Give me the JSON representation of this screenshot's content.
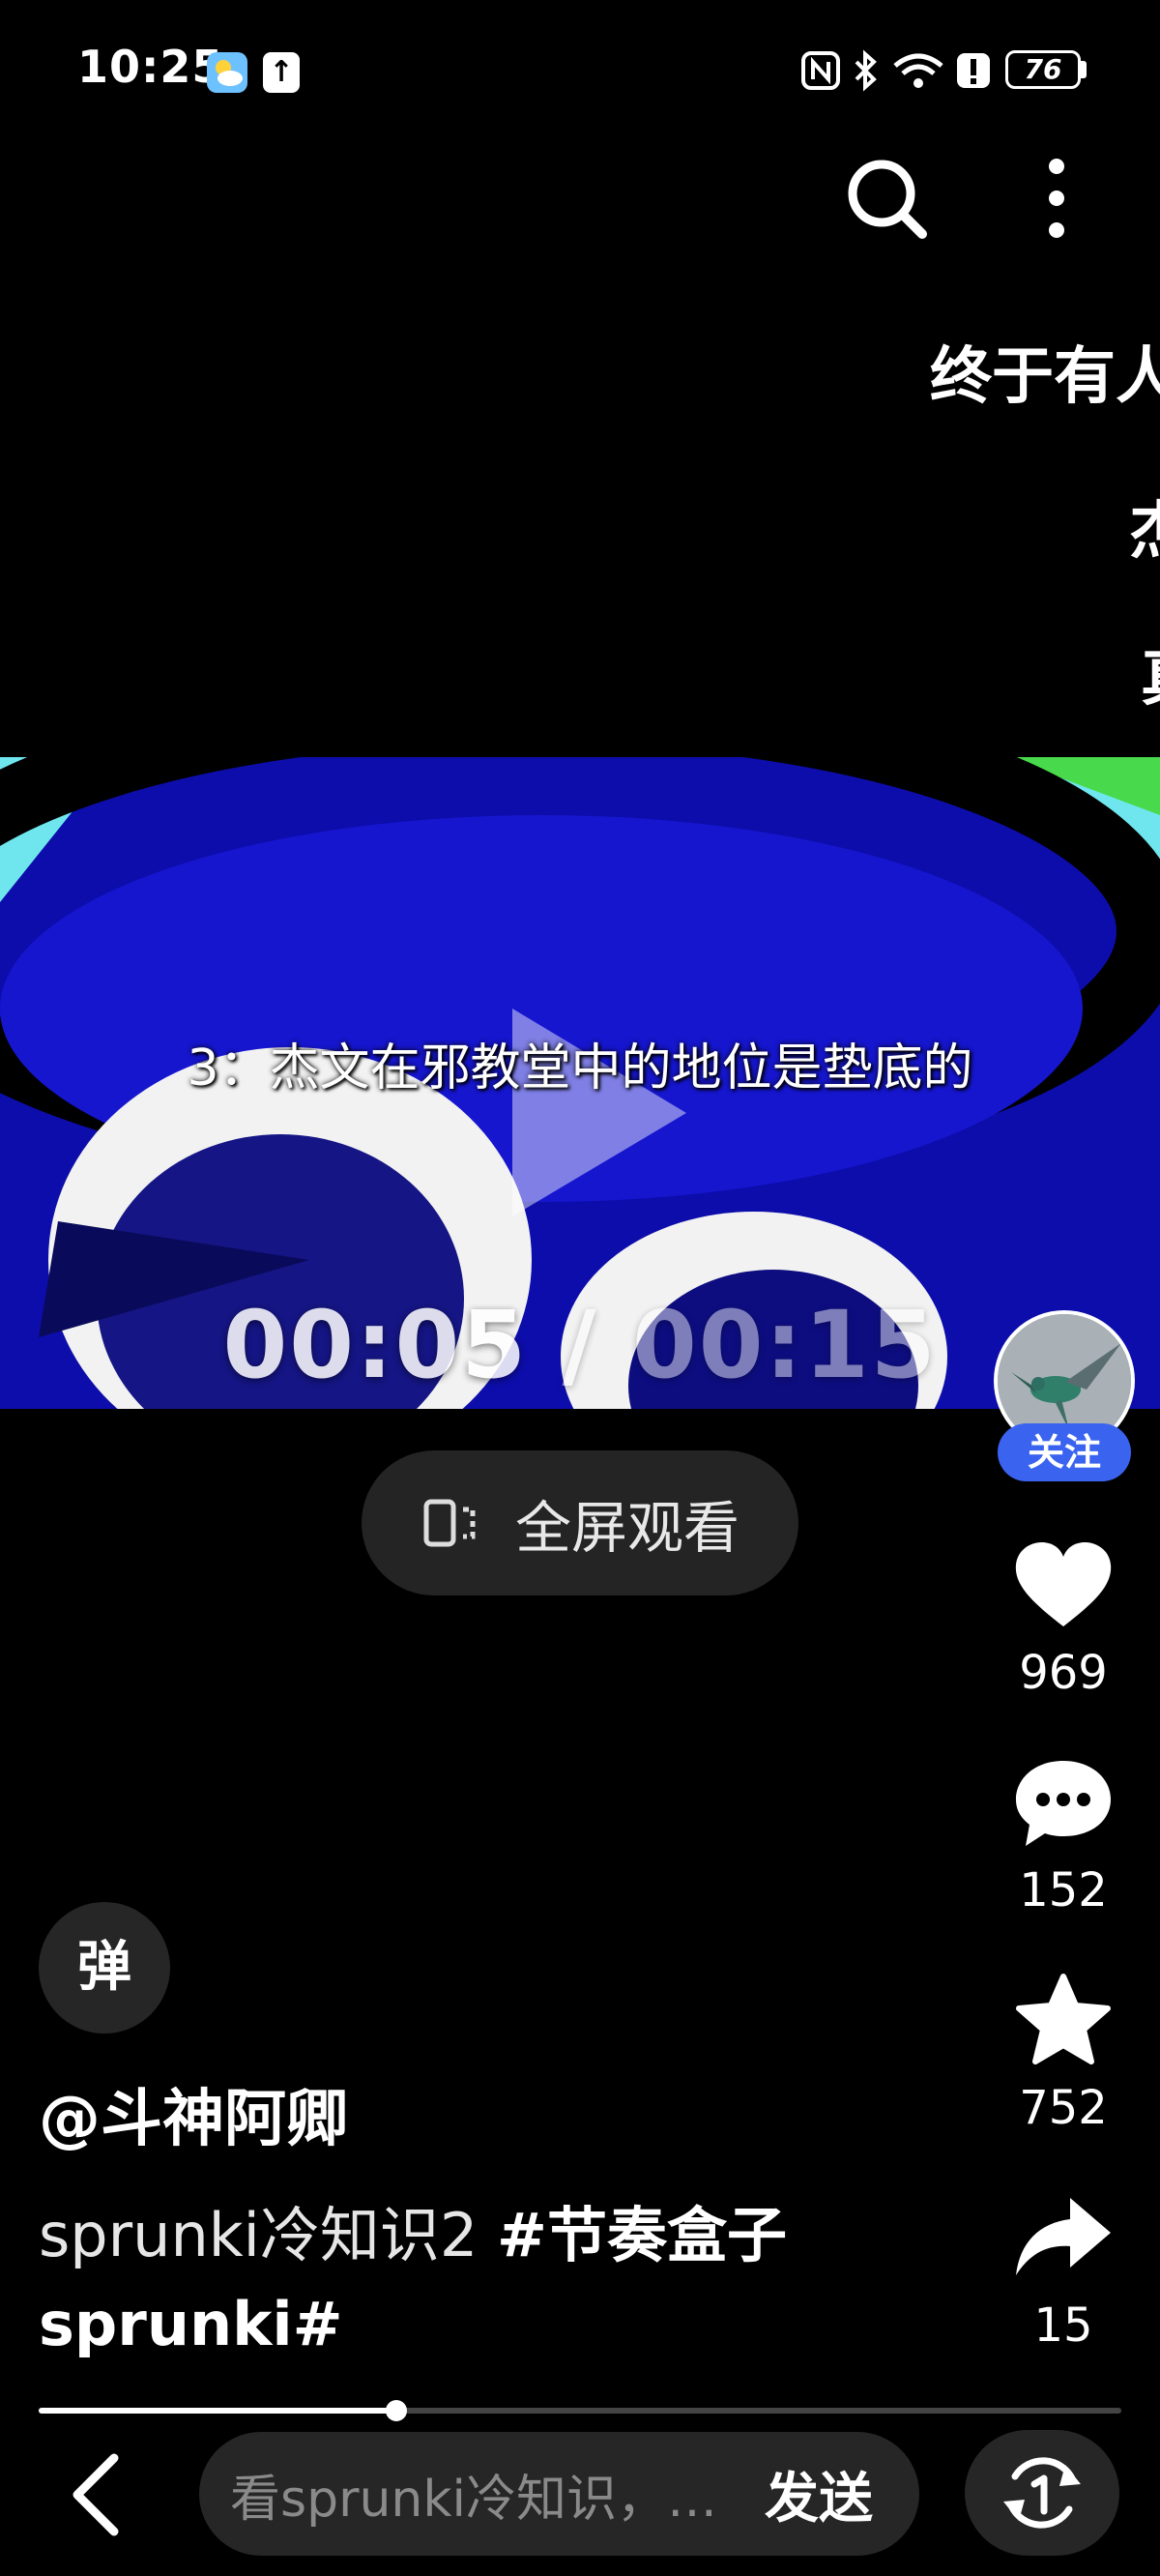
{
  "status_bar": {
    "time": "10:25",
    "upload_icon": "↑",
    "battery": "76"
  },
  "top": {
    "search_icon": "search-icon",
    "more_icon": "more-vertical-icon"
  },
  "edge_text": {
    "line1": "终于有人",
    "line2": "杰",
    "line3": "真"
  },
  "video": {
    "subtitle": "3：杰文在邪教堂中的地位是垫底的",
    "time_current": "00:05",
    "time_separator": " / ",
    "time_total": "00:15",
    "progress_fraction": 0.33
  },
  "fullscreen": {
    "label": "全屏观看"
  },
  "actions": {
    "follow_label": "关注",
    "likes": "969",
    "comments": "152",
    "favorites": "752",
    "shares": "15"
  },
  "danmaku": {
    "label": "弹"
  },
  "post": {
    "author": "@斗神阿卿",
    "caption_text": "sprunki冷知识2 ",
    "caption_tag": "#节奏盒子sprunki#"
  },
  "bottom_bar": {
    "comment_placeholder": "看sprunki冷知识，…",
    "send_label": "发送"
  },
  "colors": {
    "background": "#000000",
    "follow_button": "#3a64f0",
    "video_blue": "#0a0a8e"
  }
}
